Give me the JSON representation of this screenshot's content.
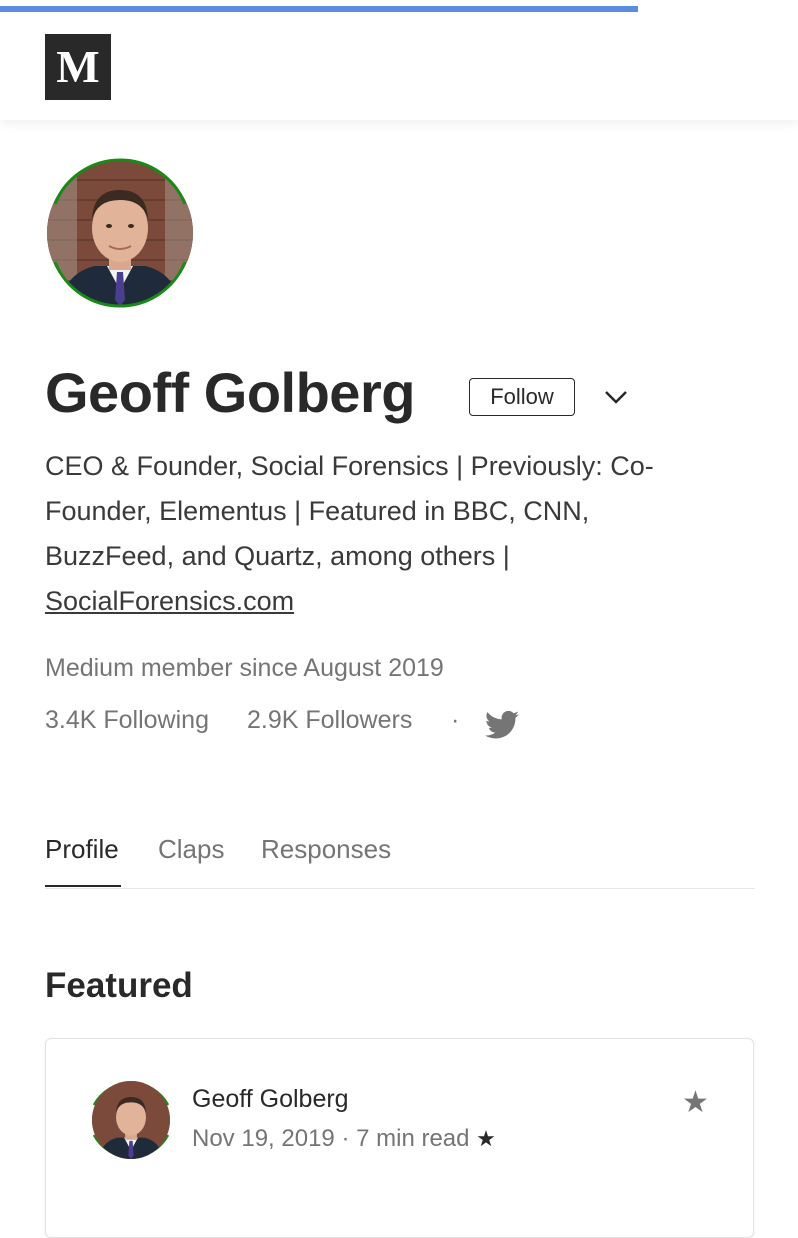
{
  "progress": {
    "fraction": 0.8,
    "color": "#5b8be3"
  },
  "header": {
    "logo_letter": "M",
    "logo_icon": "medium-logo-icon"
  },
  "profile": {
    "name": "Geoff Golberg",
    "follow_label": "Follow",
    "menu_icon": "chevron-down-icon",
    "bio": "CEO & Founder, Social Forensics | Previously: Co-Founder, Elementus | Featured in BBC, CNN, BuzzFeed, and Quartz, among others |",
    "website": "SocialForensics.com",
    "member_since": "Medium member since August 2019",
    "following": "3.4K Following",
    "followers": "2.9K Followers",
    "separator": "·",
    "social_icon": "twitter-icon",
    "ring_color": "#1a8917"
  },
  "tabs": [
    {
      "label": "Profile",
      "active": true
    },
    {
      "label": "Claps",
      "active": false
    },
    {
      "label": "Responses",
      "active": false
    }
  ],
  "featured": {
    "title": "Featured",
    "card": {
      "author": "Geoff Golberg",
      "date_read": "Nov 19, 2019 · 7 min read",
      "member_star": "★",
      "bookmark_icon": "★"
    }
  }
}
